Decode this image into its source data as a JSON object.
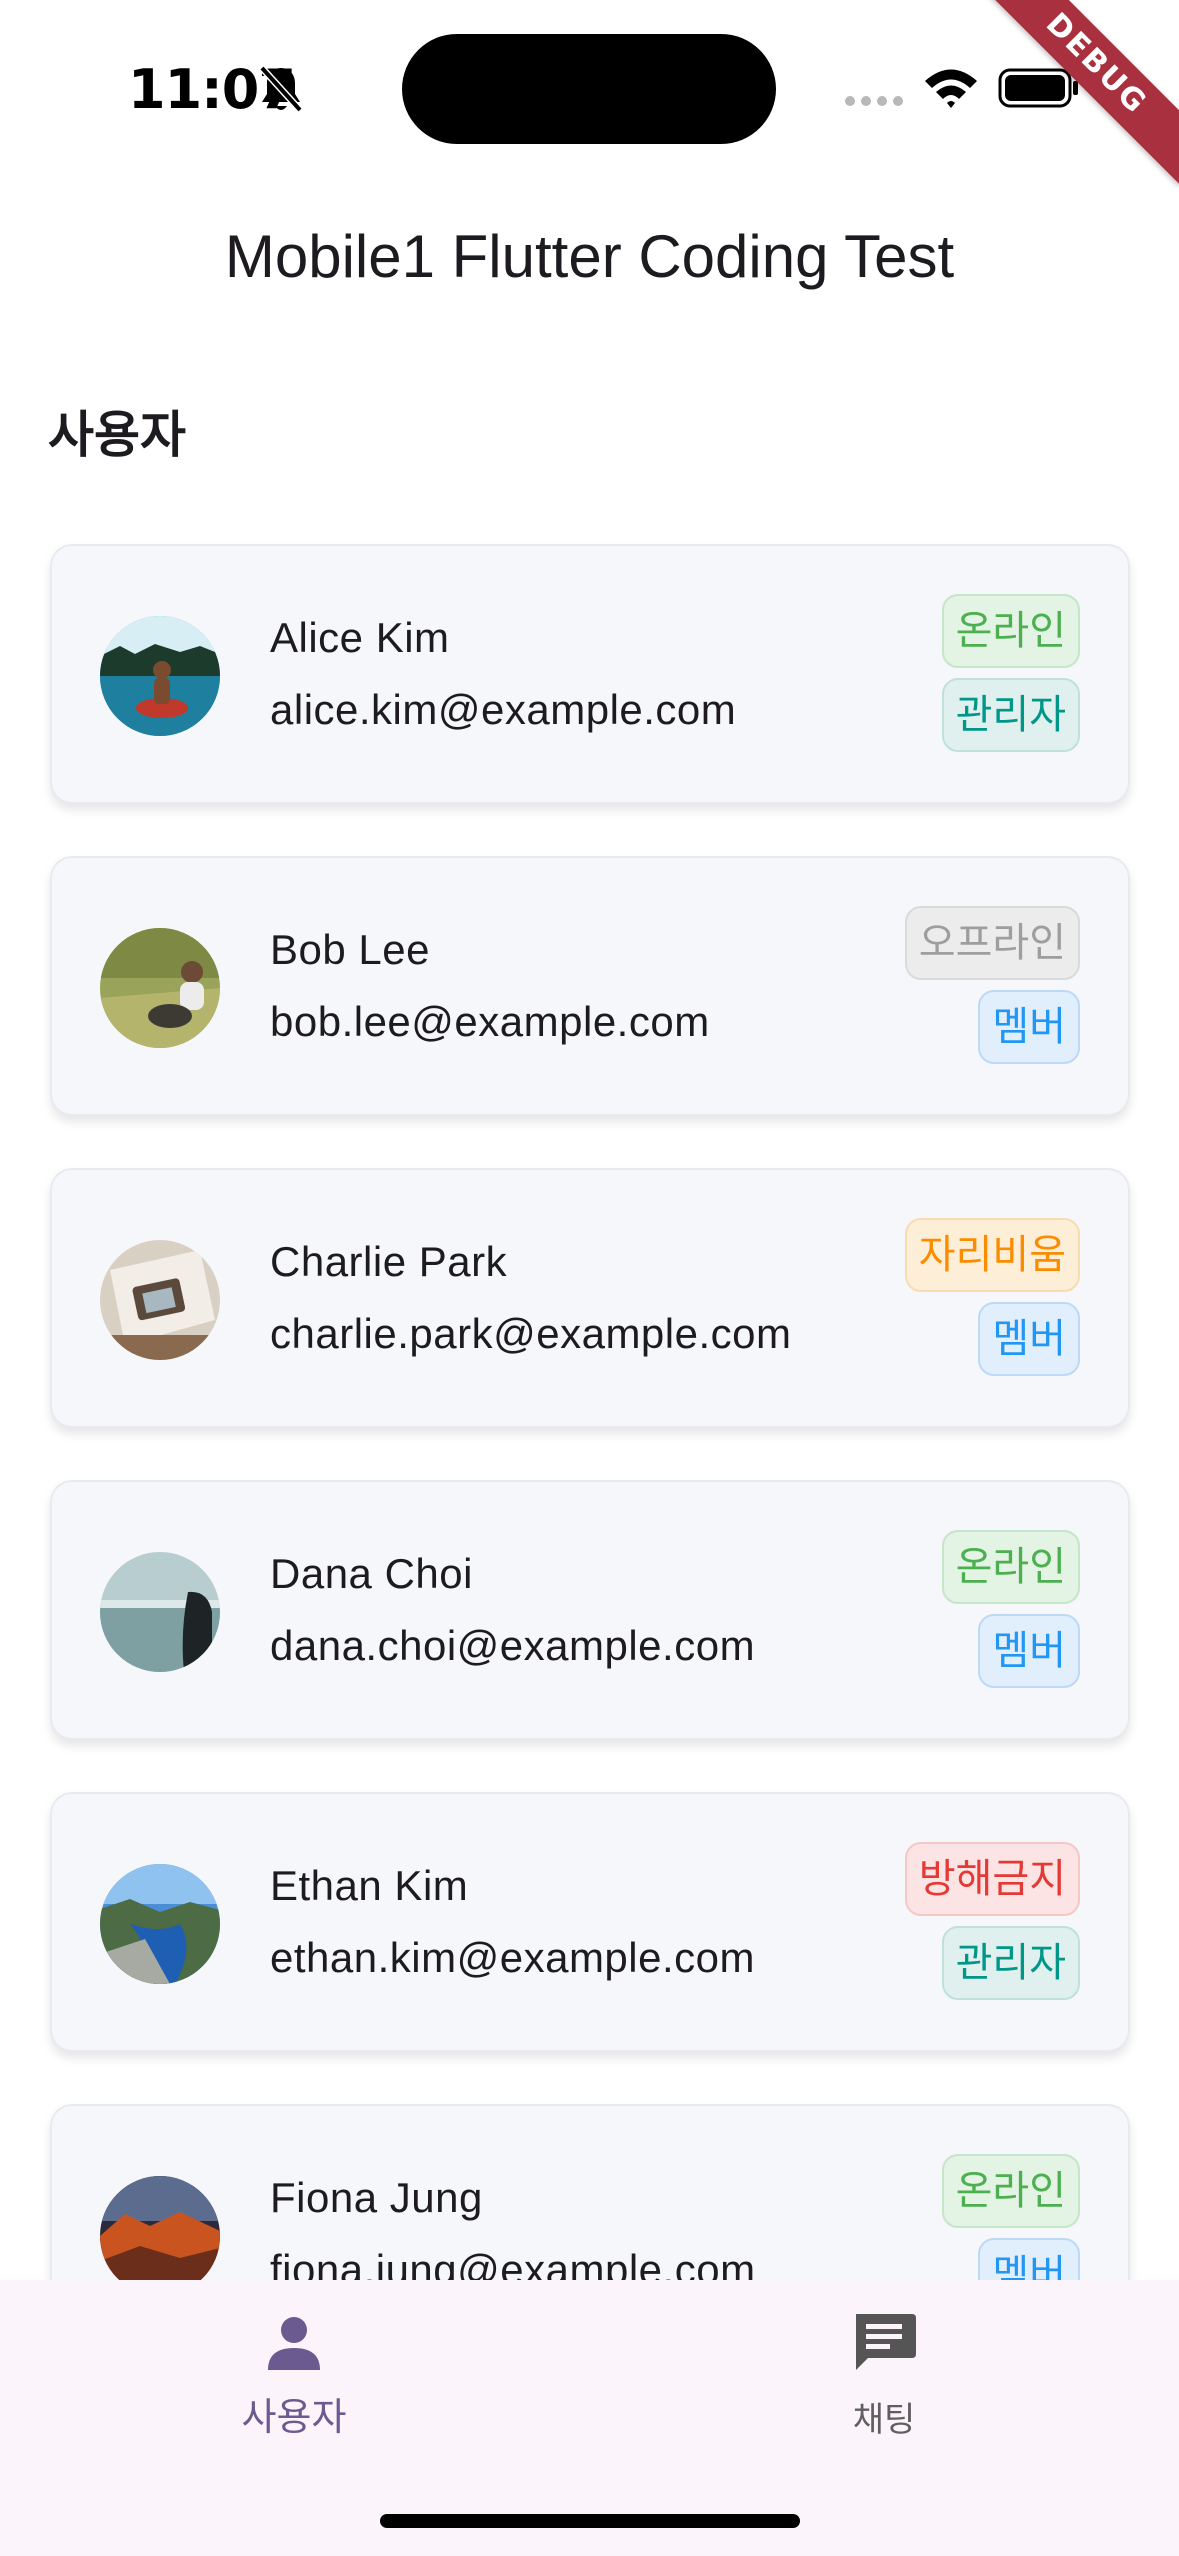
{
  "status_bar": {
    "time": "11:07"
  },
  "debug_banner": "DEBUG",
  "app_bar": {
    "title": "Mobile1 Flutter Coding Test"
  },
  "section": {
    "title": "사용자"
  },
  "users": [
    {
      "name": "Alice Kim",
      "email": "alice.kim@example.com",
      "status": "온라인",
      "role": "관리자"
    },
    {
      "name": "Bob Lee",
      "email": "bob.lee@example.com",
      "status": "오프라인",
      "role": "멤버"
    },
    {
      "name": "Charlie Park",
      "email": "charlie.park@example.com",
      "status": "자리비움",
      "role": "멤버"
    },
    {
      "name": "Dana Choi",
      "email": "dana.choi@example.com",
      "status": "온라인",
      "role": "멤버"
    },
    {
      "name": "Ethan Kim",
      "email": "ethan.kim@example.com",
      "status": "방해금지",
      "role": "관리자"
    },
    {
      "name": "Fiona Jung",
      "email": "fiona.jung@example.com",
      "status": "온라인",
      "role": "멤버"
    }
  ],
  "bottom_nav": {
    "items": [
      {
        "label": "사용자",
        "icon": "person-icon",
        "selected": true
      },
      {
        "label": "채팅",
        "icon": "chat-icon",
        "selected": false
      }
    ]
  },
  "colors": {
    "online": "#4caf50",
    "offline": "#9e9e9e",
    "away": "#fb8c00",
    "dnd": "#e53935",
    "admin": "#009688",
    "member": "#2196f3",
    "nav_selected": "#6a5a8f"
  }
}
